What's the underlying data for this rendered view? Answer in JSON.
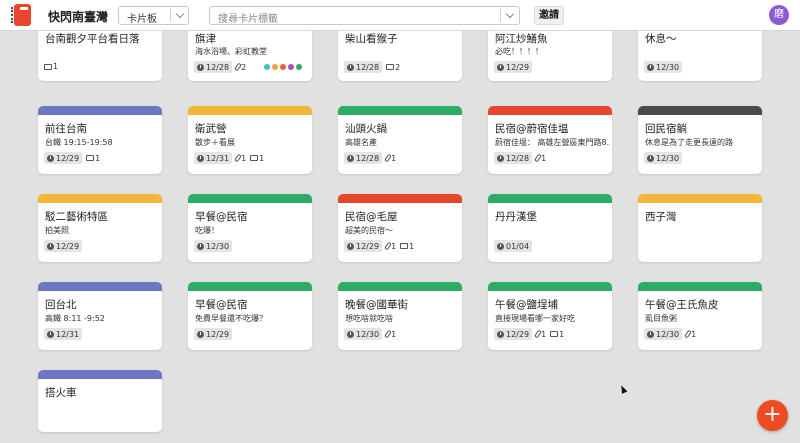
{
  "app": {
    "title": "快閃南臺灣",
    "board_select": "卡片板",
    "search_placeholder": "搜尋卡片標籤",
    "invite_label": "邀請",
    "avatar_initial": "磨",
    "fab_label": "+"
  },
  "colors": {
    "red": "#e8472e",
    "blue": "#6f76c4",
    "yellow": "#f2b63a",
    "green": "#2eab67",
    "dark": "#4a4a4a",
    "accent": "#ee4b23"
  },
  "label_dots": [
    "#35c6cf",
    "#f2a43a",
    "#ef5f2f",
    "#9b59b6",
    "#2eab67"
  ],
  "cards": [
    {
      "title": "台南觀夕平台看日落",
      "desc": "",
      "date": "",
      "attach": "",
      "comments": "1"
    },
    {
      "title": "旗津",
      "desc": "海水浴場、彩虹教堂",
      "date": "12/28",
      "attach": "2",
      "comments": ""
    },
    {
      "title": "柴山看猴子",
      "desc": "",
      "date": "12/28",
      "attach": "",
      "comments": "2"
    },
    {
      "title": "阿江炒鱔魚",
      "desc": "必吃！！！！",
      "date": "12/29",
      "attach": "",
      "comments": ""
    },
    {
      "title": "休息〜",
      "desc": "",
      "date": "12/30",
      "attach": "",
      "comments": ""
    },
    {
      "title": "前往台南",
      "desc": "台鐵 19:15-19:58",
      "date": "12/29",
      "attach": "",
      "comments": "1"
    },
    {
      "title": "衛武營",
      "desc": "散步＋看展",
      "date": "12/31",
      "attach": "1",
      "comments": "1"
    },
    {
      "title": "汕頭火鍋",
      "desc": "高雄名產",
      "date": "12/28",
      "attach": "1",
      "comments": ""
    },
    {
      "title": "民宿@蔚宿佳塭",
      "desc": "蔚宿佳塭： 高雄左營區東門路8...",
      "date": "12/28",
      "attach": "1",
      "comments": ""
    },
    {
      "title": "回民宿躺",
      "desc": "休息是為了走更長遠的路",
      "date": "12/30",
      "attach": "",
      "comments": ""
    },
    {
      "title": "駁二藝術特區",
      "desc": "拍美照",
      "date": "12/29",
      "attach": "",
      "comments": ""
    },
    {
      "title": "早餐@民宿",
      "desc": "吃爆！",
      "date": "12/30",
      "attach": "",
      "comments": ""
    },
    {
      "title": "民宿@毛屋",
      "desc": "超美的民宿〜",
      "date": "12/29",
      "attach": "1",
      "comments": "1"
    },
    {
      "title": "丹丹漢堡",
      "desc": "",
      "date": "01/04",
      "attach": "",
      "comments": ""
    },
    {
      "title": "西子灣",
      "desc": "",
      "date": "",
      "attach": "",
      "comments": ""
    },
    {
      "title": "回台北",
      "desc": "高鐵 8:11 -9:52",
      "date": "12/31",
      "attach": "",
      "comments": ""
    },
    {
      "title": "早餐@民宿",
      "desc": "免費早餐還不吃爆？",
      "date": "12/29",
      "attach": "",
      "comments": ""
    },
    {
      "title": "晚餐@國華街",
      "desc": "想吃啥就吃啥",
      "date": "12/30",
      "attach": "1",
      "comments": ""
    },
    {
      "title": "午餐@鹽埕埔",
      "desc": "直接現場看哪一家好吃",
      "date": "12/29",
      "attach": "1",
      "comments": "1"
    },
    {
      "title": "午餐@王氏魚皮",
      "desc": "虱目魚粥",
      "date": "12/30",
      "attach": "1",
      "comments": ""
    },
    {
      "title": "搭火車",
      "desc": "",
      "date": "",
      "attach": "",
      "comments": ""
    }
  ]
}
